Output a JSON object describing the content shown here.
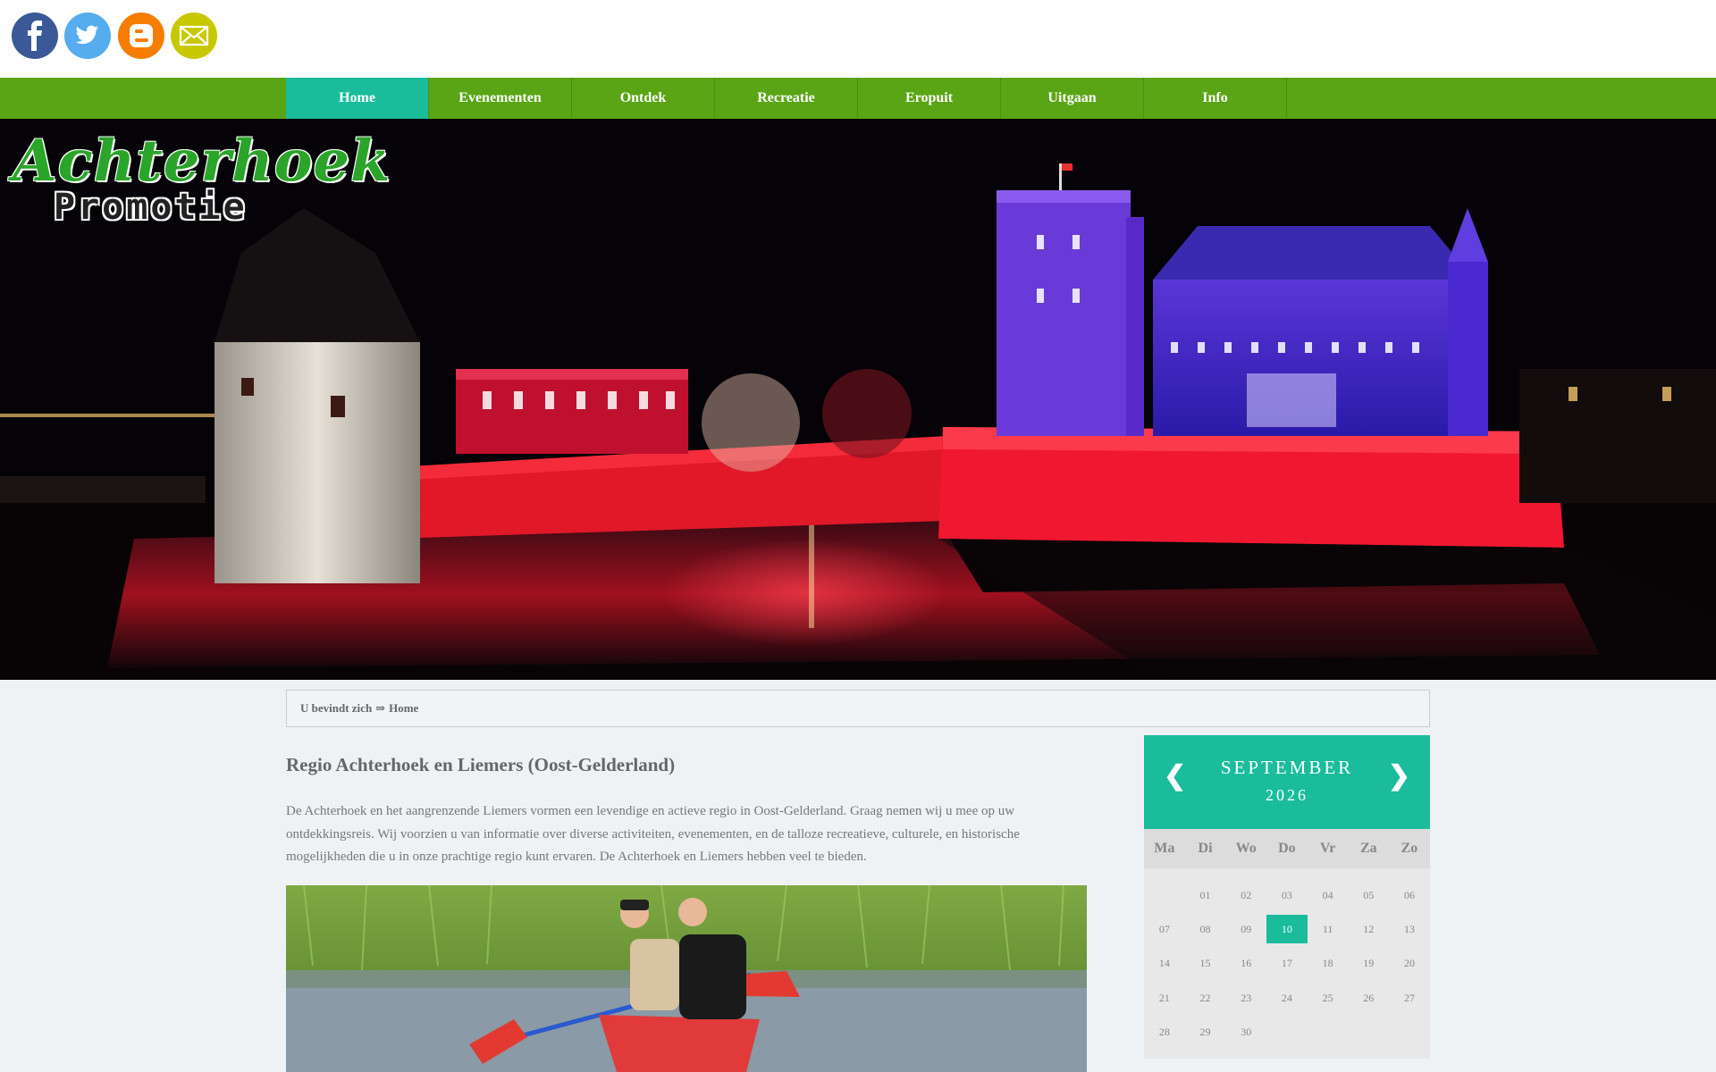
{
  "social": [
    {
      "name": "facebook-icon",
      "color": "#3b5998"
    },
    {
      "name": "twitter-icon",
      "color": "#55acee"
    },
    {
      "name": "blogger-icon",
      "color": "#f57d00"
    },
    {
      "name": "email-icon",
      "color": "#c8c800"
    }
  ],
  "nav": {
    "items": [
      "Home",
      "Evenementen",
      "Ontdek",
      "Recreatie",
      "Eropuit",
      "Uitgaan",
      "Info"
    ],
    "active": "Home"
  },
  "logo": {
    "line1": "Achterhoek",
    "line2": "Promotie"
  },
  "breadcrumb": {
    "prefix": "U bevindt zich",
    "separator": "⇒",
    "current": "Home"
  },
  "main": {
    "title": "Regio Achterhoek en Liemers (Oost-Gelderland)",
    "intro": "De Achterhoek en het aangrenzende Liemers vormen een levendige en actieve regio in Oost-Gelderland. Graag nemen wij u mee op uw ontdekkingsreis. Wij voorzien u van informatie over diverse activiteiten, evenementen, en de talloze recreatieve, culturele, en historische mogelijkheden die u in onze prachtige regio kunt ervaren. De Achterhoek en Liemers hebben veel te bieden."
  },
  "calendar": {
    "month": "SEPTEMBER",
    "year": "2026",
    "prev": "❮",
    "next": "❯",
    "weekdays": [
      "Ma",
      "Di",
      "Wo",
      "Do",
      "Vr",
      "Za",
      "Zo"
    ],
    "days": [
      "",
      "01",
      "02",
      "03",
      "04",
      "05",
      "06",
      "07",
      "08",
      "09",
      "10",
      "11",
      "12",
      "13",
      "14",
      "15",
      "16",
      "17",
      "18",
      "19",
      "20",
      "21",
      "22",
      "23",
      "24",
      "25",
      "26",
      "27",
      "28",
      "29",
      "30"
    ],
    "today": "10",
    "accent": "#1abc9c"
  },
  "colors": {
    "nav_bg": "#5aa515",
    "nav_active": "#1abc9c"
  }
}
